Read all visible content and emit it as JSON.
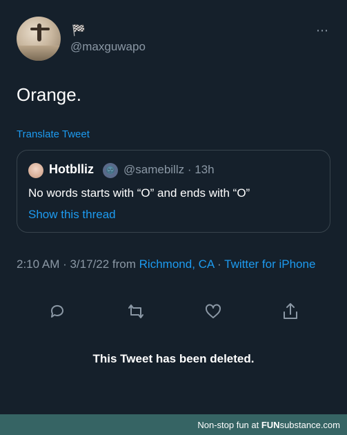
{
  "author": {
    "name_emoji": "🏁",
    "handle": "@maxguwapo"
  },
  "more_icon": "⋯",
  "tweet": {
    "text": "Orange.",
    "translate_label": "Translate Tweet"
  },
  "quoted_tweet": {
    "name": "Hotblliz",
    "emoji": "🌚",
    "handle_time": "@samebillz · 13h",
    "text": "No words starts with “O” and ends with “O”",
    "thread_link": "Show this thread"
  },
  "meta": {
    "time_date": "2:10 AM · 3/17/22 from ",
    "location": "Richmond, CA",
    "sep": " · ",
    "source": "Twitter for iPhone"
  },
  "actions": [
    "reply-icon",
    "retweet-icon",
    "like-icon",
    "share-icon"
  ],
  "deleted_notice": "This Tweet has been deleted.",
  "footer": {
    "prefix": "Non-stop fun at ",
    "brand_bold": "FUN",
    "brand_rest": "substance.com"
  },
  "colors": {
    "background": "#15202b",
    "link": "#1d9bf0",
    "secondary": "#8b98a5",
    "footer": "#366464"
  }
}
